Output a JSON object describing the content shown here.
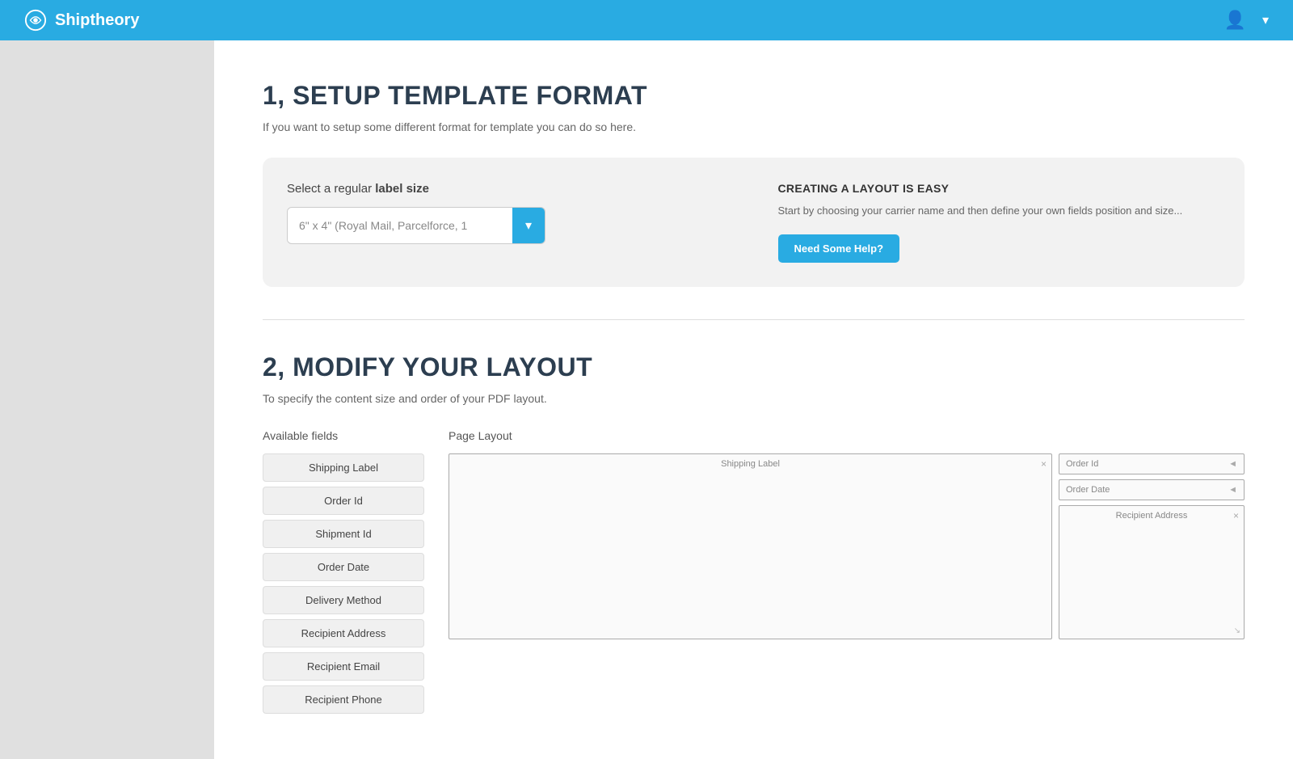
{
  "header": {
    "logo_text": "Shiptheory",
    "user_icon": "👤",
    "chevron": "▾"
  },
  "section1": {
    "title": "1, SETUP TEMPLATE FORMAT",
    "subtitle": "If you want to setup some different format for template you can do so here.",
    "label_size_label": "Select a regular",
    "label_size_bold": "label size",
    "select_value": "6\" x 4\" (Royal Mail, Parcelforce, 1",
    "help_title": "CREATING A LAYOUT IS EASY",
    "help_text": "Start by choosing your carrier name and then define your own fields position and size...",
    "help_btn": "Need Some Help?"
  },
  "section2": {
    "title": "2, MODIFY YOUR LAYOUT",
    "subtitle": "To specify the content size and order of your PDF layout.",
    "available_fields_label": "Available fields",
    "page_layout_label": "Page Layout",
    "fields": [
      "Shipping Label",
      "Order Id",
      "Shipment Id",
      "Order Date",
      "Delivery Method",
      "Recipient Address",
      "Recipient Email",
      "Recipient Phone"
    ],
    "layout_shipping_label": "Shipping Label",
    "layout_fields": [
      {
        "label": "Order Id",
        "icon": "◄"
      },
      {
        "label": "Order Date",
        "icon": "◄"
      }
    ],
    "layout_recipient_label": "Recipient Address",
    "close_x": "×"
  }
}
